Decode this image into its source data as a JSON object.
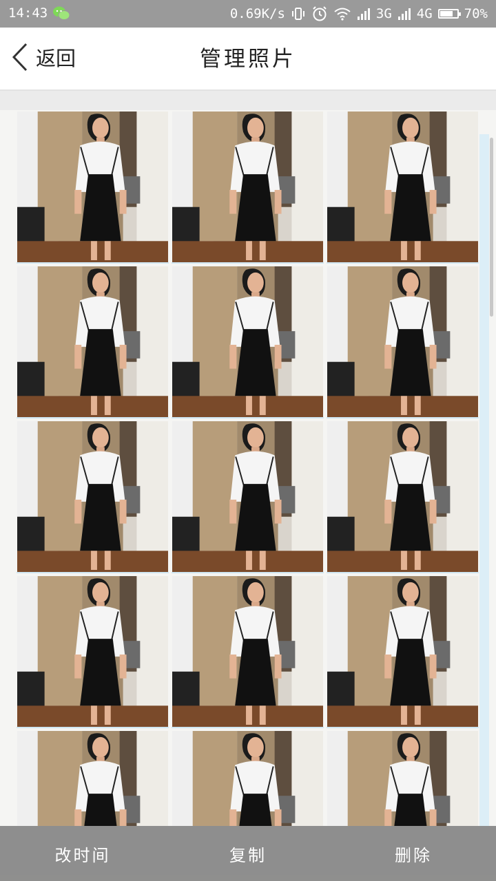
{
  "status_bar": {
    "time": "14:43",
    "app_icon": "wechat-icon",
    "net_speed": "0.69K/s",
    "icons": [
      "vibrate-icon",
      "alarm-icon",
      "wifi-icon",
      "signal-3g-icon",
      "signal-4g-icon",
      "battery-icon"
    ],
    "label_3g": "3G",
    "label_4g": "4G",
    "battery": "70%",
    "battery_level": 0.7
  },
  "header": {
    "back_label": "返回",
    "title": "管理照片"
  },
  "photos": {
    "count": 15,
    "columns": 3
  },
  "bottom_bar": {
    "edit_time_label": "改时间",
    "copy_label": "复制",
    "delete_label": "删除"
  },
  "colors": {
    "status_bg": "#9a9a9a",
    "header_bg": "#ffffff",
    "bottom_bg": "#787878",
    "accent_strip": "#dceef7"
  }
}
